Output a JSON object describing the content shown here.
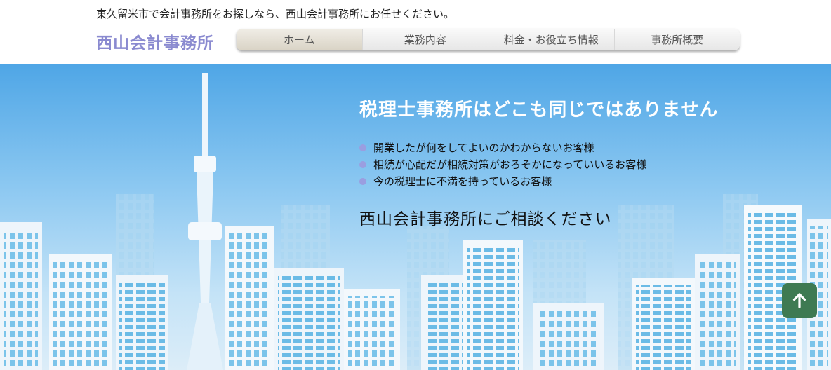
{
  "header": {
    "tagline": "東久留米市で会計事務所をお探しなら、西山会計事務所にお任せください。",
    "logo": "西山会計事務所"
  },
  "nav": {
    "items": [
      {
        "label": "ホーム",
        "active": true
      },
      {
        "label": "業務内容"
      },
      {
        "label": "料金・お役立ち情報"
      },
      {
        "label": "事務所概要"
      }
    ]
  },
  "hero": {
    "title": "税理士事務所はどこも同じではありません",
    "bullets": [
      "開業したが何をしてよいのかわからないお客様",
      "相続が心配だが相続対策がおろそかになっていいるお客様",
      "今の税理士に不満を持っているお客様"
    ],
    "cta": "西山会計事務所にご相談ください"
  },
  "back_to_top": {
    "icon": "arrow-up-icon"
  },
  "colors": {
    "logo": "#8a8ad0",
    "bullet": "#9a9ee0",
    "back_to_top": "#3e7a52",
    "sky_top": "#4fa6e6"
  }
}
